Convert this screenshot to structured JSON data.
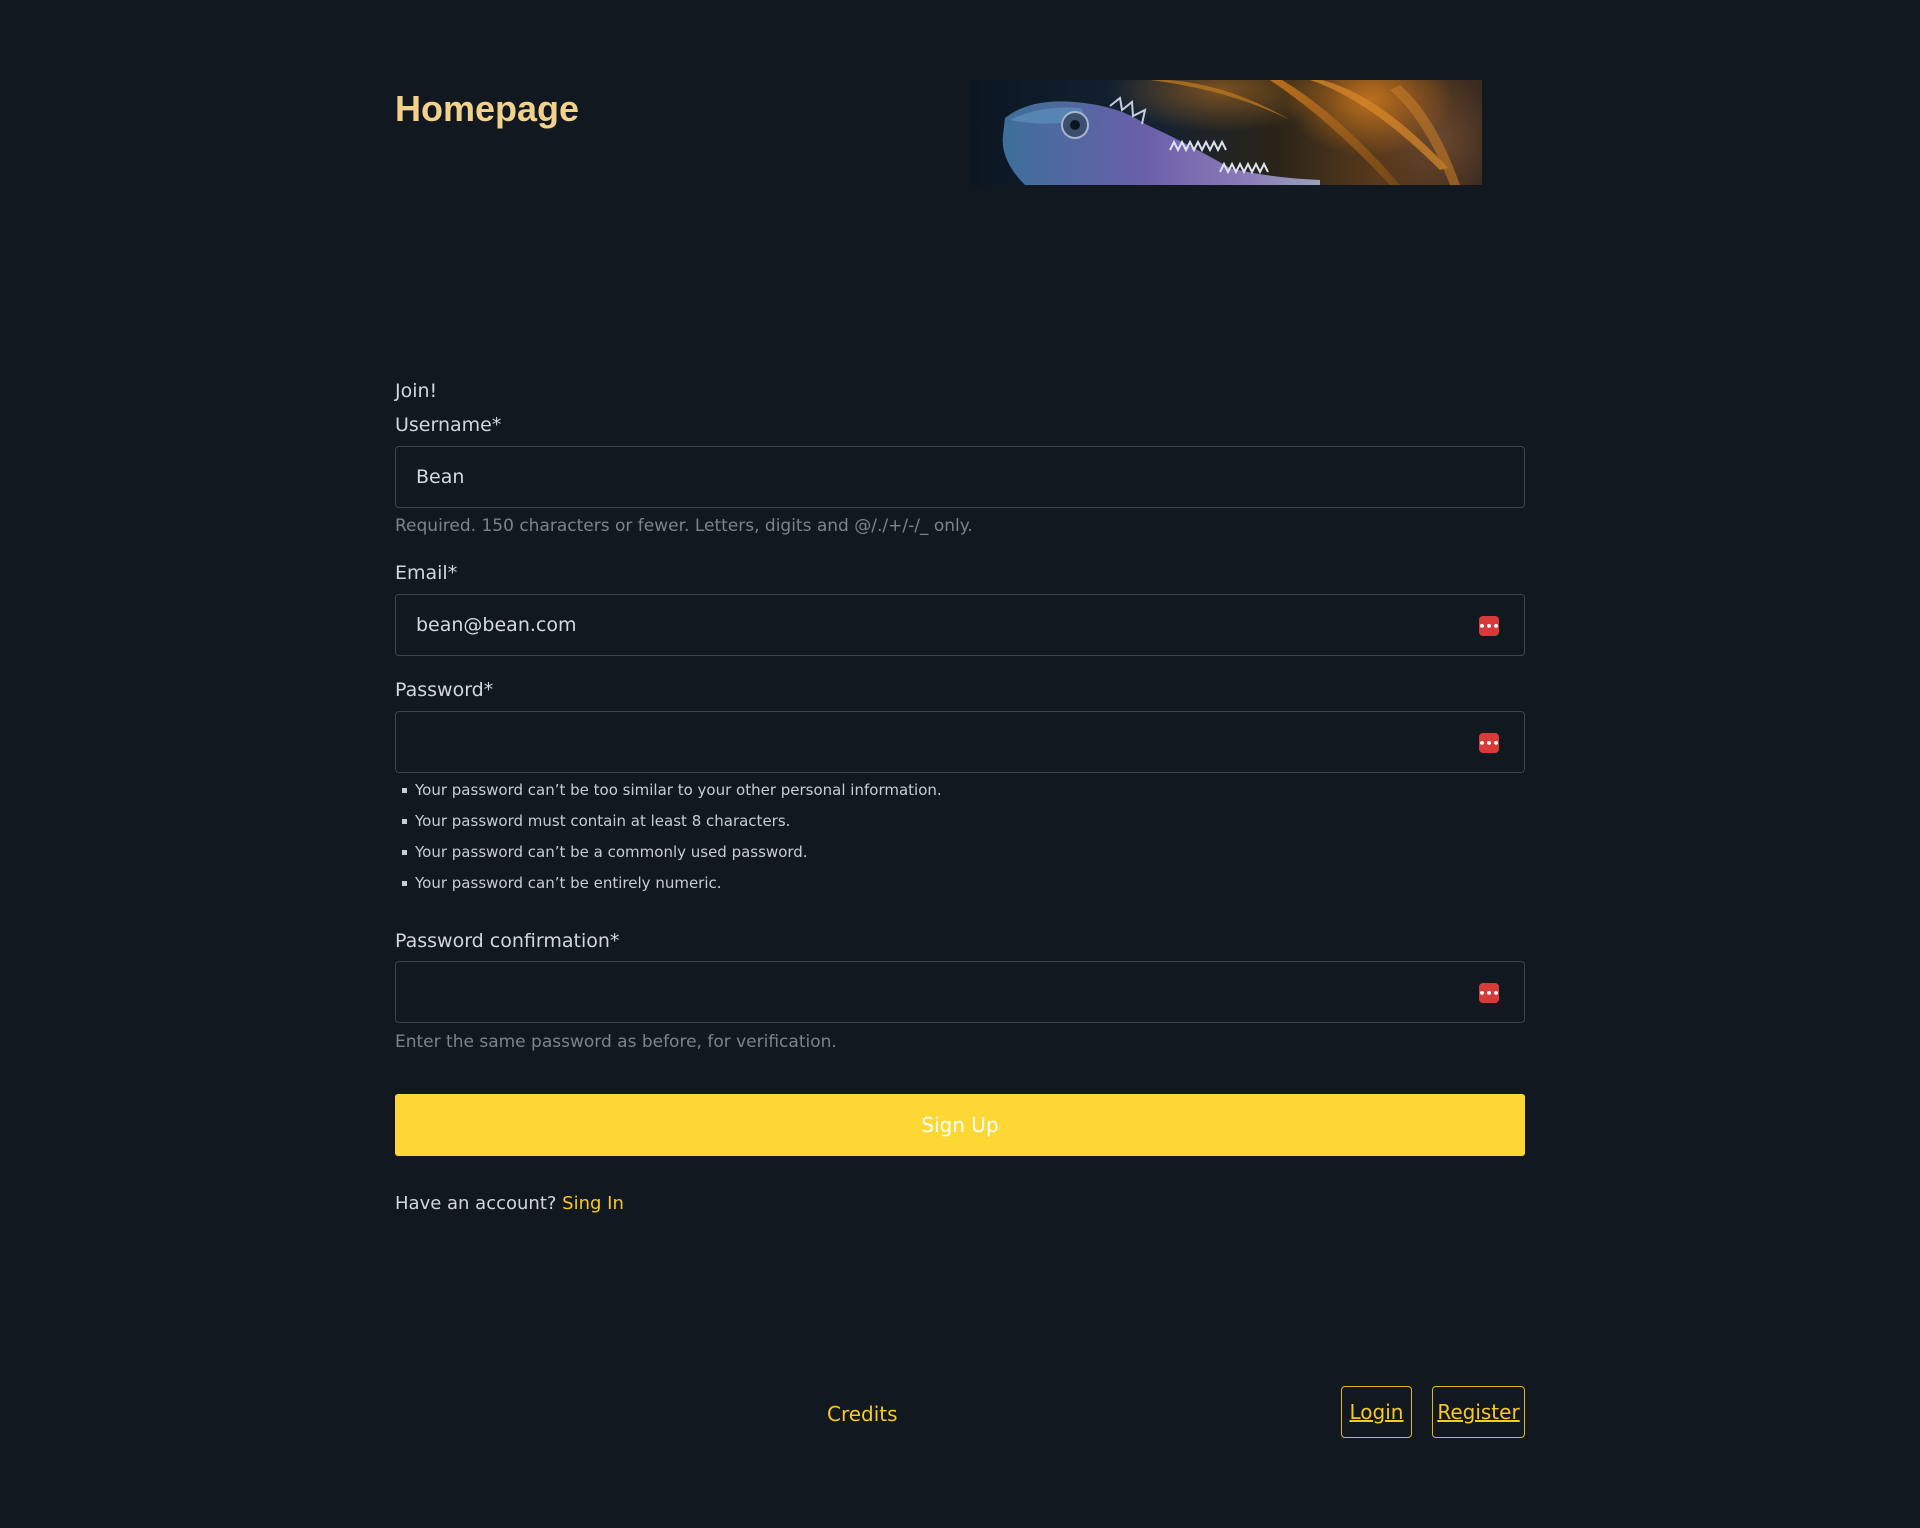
{
  "header": {
    "title": "Homepage",
    "banner_image": "chameleon-banner"
  },
  "form": {
    "heading": "Join!",
    "username": {
      "label": "Username*",
      "value": "Bean",
      "help": "Required. 150 characters or fewer. Letters, digits and @/./+/-/_ only."
    },
    "email": {
      "label": "Email*",
      "value": "bean@bean.com"
    },
    "password": {
      "label": "Password*",
      "value": "",
      "rules": [
        "Your password can’t be too similar to your other personal information.",
        "Your password must contain at least 8 characters.",
        "Your password can’t be a commonly used password.",
        "Your password can’t be entirely numeric."
      ]
    },
    "password_confirmation": {
      "label": "Password confirmation*",
      "value": "",
      "help": "Enter the same password as before, for verification."
    },
    "submit_label": "Sign Up",
    "have_account_text": "Have an account?",
    "sign_in_link": "Sing In",
    "password_manager_icon": "password-manager-icon",
    "password_manager_glyph": "•••"
  },
  "footer": {
    "credits": "Credits",
    "login": "Login",
    "register": "Register"
  },
  "colors": {
    "background": "#121820",
    "title": "#f2d28a",
    "accent": "#fdd835",
    "link": "#f7c922",
    "password_manager": "#d83a3a"
  }
}
